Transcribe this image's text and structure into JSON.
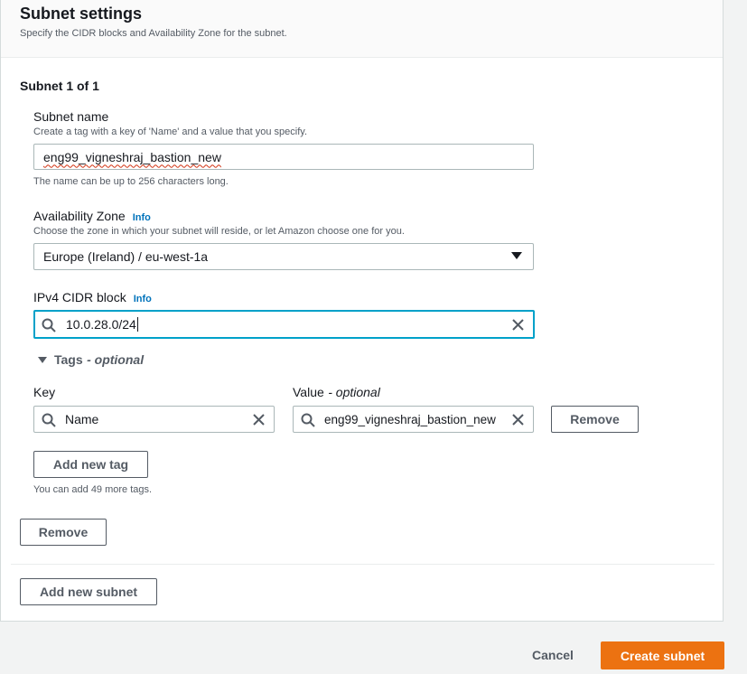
{
  "header": {
    "title": "Subnet settings",
    "subtitle": "Specify the CIDR blocks and Availability Zone for the subnet."
  },
  "subnet": {
    "heading": "Subnet 1 of 1",
    "name_label": "Subnet name",
    "name_desc": "Create a tag with a key of 'Name' and a value that you specify.",
    "name_value": "eng99_vigneshraj_bastion_new",
    "name_hint": "The name can be up to 256 characters long.",
    "az_label": "Availability Zone",
    "az_info": "Info",
    "az_desc": "Choose the zone in which your subnet will reside, or let Amazon choose one for you.",
    "az_value": "Europe (Ireland) / eu-west-1a",
    "cidr_label": "IPv4 CIDR block",
    "cidr_info": "Info",
    "cidr_value": "10.0.28.0/24",
    "remove_label": "Remove"
  },
  "tags": {
    "toggle_label": "Tags",
    "toggle_optional": "- optional",
    "key_header": "Key",
    "value_header": "Value",
    "value_optional": "- optional",
    "rows": [
      {
        "key": "Name",
        "value": "eng99_vigneshraj_bastion_new",
        "remove_label": "Remove"
      }
    ],
    "add_label": "Add new tag",
    "limit_hint": "You can add 49 more tags."
  },
  "add_subnet_label": "Add new subnet",
  "footer": {
    "cancel_label": "Cancel",
    "create_label": "Create subnet"
  },
  "colors": {
    "primary": "#ec7211",
    "info_link": "#0073bb",
    "focus": "#00a1c9"
  }
}
